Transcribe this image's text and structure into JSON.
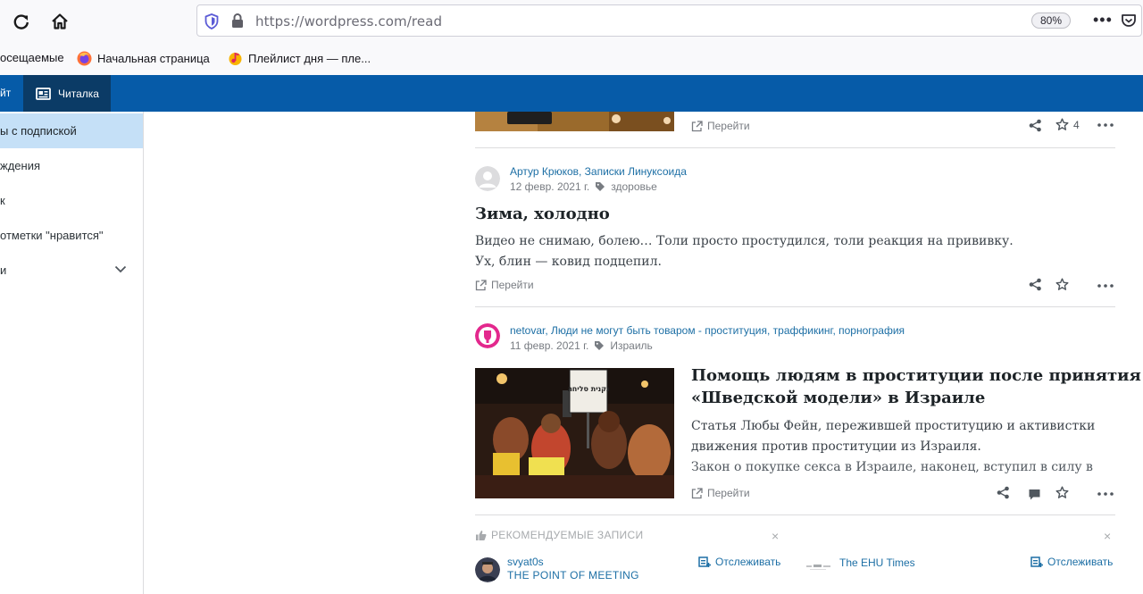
{
  "browser": {
    "url": "https://wordpress.com/read",
    "zoom": "80%",
    "more": "•••",
    "bookmarks": [
      {
        "label": "осещаемые",
        "icon": "none"
      },
      {
        "label": "Начальная страница",
        "icon": "firefox-icon"
      },
      {
        "label": "Плейлист дня — пле...",
        "icon": "music-icon"
      }
    ]
  },
  "masterbar": {
    "site_label": "йт",
    "reader_label": "Читалка"
  },
  "sidebar": {
    "items": [
      {
        "label": "ы с подпиской",
        "active": true
      },
      {
        "label": "ждения",
        "active": false
      },
      {
        "label": "к",
        "active": false
      },
      {
        "label": "отметки \"нравится\"",
        "active": false
      },
      {
        "label": "и",
        "active": false
      }
    ]
  },
  "posts": [
    {
      "visit_label": "Перейти",
      "like_count": "4"
    },
    {
      "author": "Артур Крюков, Записки Линуксоида",
      "date": "12 февр. 2021 г.",
      "tag": "здоровье",
      "title": "Зима, холодно",
      "excerpt_lines": [
        "Видео не снимаю, болею… Толи просто простудился, толи реакция на прививку.",
        "Ух, блин — ковид подцепил."
      ],
      "visit_label": "Перейти"
    },
    {
      "author": "netovar, Люди не могут быть товаром - проституция, траффикинг, порнография",
      "date": "11 февр. 2021 г.",
      "tag": "Израиль",
      "title_lines": [
        "Помощь людям в проституции после принятия",
        "«Шведской модели» в Израиле"
      ],
      "excerpt_lines": [
        "Статья Любы Фейн, пережившей проституцию и активистки",
        "движения против проституции из Израиля.",
        "Закон о покупке секса в Израиле, наконец, вступил в силу в"
      ],
      "visit_label": "Перейти",
      "sign_text": "נקנית סליחה"
    }
  ],
  "recommended": {
    "heading": "РЕКОМЕНДУЕМЫЕ ЗАПИСИ",
    "close": "×",
    "items": [
      {
        "name": "svyat0s",
        "title": "THE POINT OF MEETING",
        "follow": "Отслеживать"
      },
      {
        "name": "The EHU Times",
        "follow": "Отслеживать"
      }
    ]
  },
  "colors": {
    "masterbar": "#065ba8",
    "masterbar_active": "#0b3b66",
    "link": "#1d6fa5",
    "sidebar_active": "#c5e0f7"
  }
}
